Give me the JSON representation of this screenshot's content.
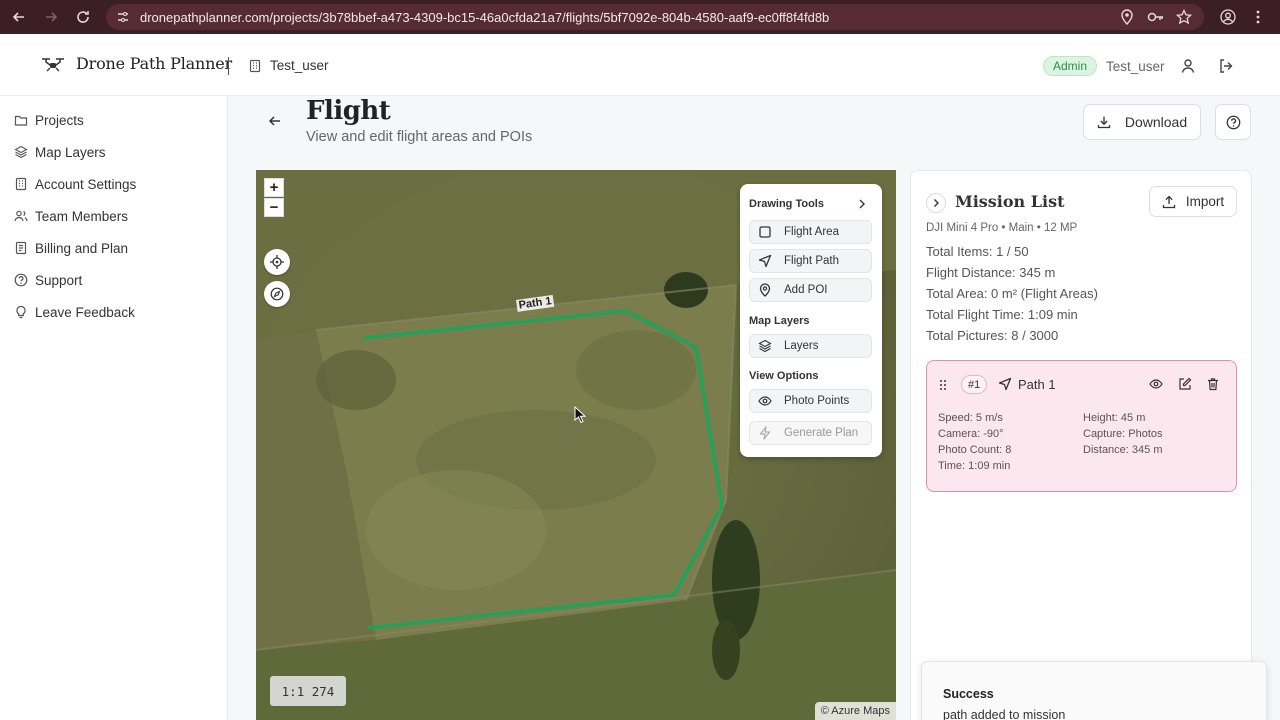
{
  "browser": {
    "url": "dronepathplanner.com/projects/3b78bbef-a473-4309-bc15-46a0cfda21a7/flights/5bf7092e-804b-4580-aaf9-ec0ff8f4fd8b"
  },
  "header": {
    "brand": "Drone Path Planner",
    "workspace": "Test_user",
    "role_badge": "Admin",
    "user": "Test_user"
  },
  "sidebar": {
    "items": [
      {
        "label": "Projects",
        "icon": "folder-icon"
      },
      {
        "label": "Map Layers",
        "icon": "layers-icon"
      },
      {
        "label": "Account Settings",
        "icon": "building-icon"
      },
      {
        "label": "Team Members",
        "icon": "users-icon"
      },
      {
        "label": "Billing and Plan",
        "icon": "receipt-icon"
      },
      {
        "label": "Support",
        "icon": "help-icon"
      },
      {
        "label": "Leave Feedback",
        "icon": "lightbulb-icon"
      }
    ]
  },
  "page": {
    "title": "Flight",
    "subtitle": "View and edit flight areas and POIs",
    "download_label": "Download"
  },
  "map": {
    "zoom_in": "+",
    "zoom_out": "−",
    "path_label": "Path 1",
    "scale": "1:1 274",
    "attribution": "© Azure Maps",
    "path_color": "#1fa35a"
  },
  "tools": {
    "drawing_title": "Drawing Tools",
    "flight_area": "Flight Area",
    "flight_path": "Flight Path",
    "add_poi": "Add POI",
    "map_layers_title": "Map Layers",
    "layers": "Layers",
    "view_options_title": "View Options",
    "photo_points": "Photo Points",
    "generate_plan": "Generate Plan"
  },
  "mission": {
    "title": "Mission List",
    "import_label": "Import",
    "drone": "DJI Mini 4 Pro • Main • 12 MP",
    "stats": [
      "Total Items: 1 / 50",
      "Flight Distance: 345 m",
      "Total Area: 0 m² (Flight Areas)",
      "Total Flight Time: 1:09 min",
      "Total Pictures: 8 / 3000"
    ],
    "item": {
      "number": "#1",
      "name": "Path 1",
      "speed": "Speed: 5 m/s",
      "height": "Height: 45 m",
      "camera": "Camera: -90°",
      "capture": "Capture: Photos",
      "photo_count": "Photo Count: 8",
      "distance": "Distance: 345 m",
      "time": "Time: 1:09 min"
    }
  },
  "toast": {
    "title": "Success",
    "message": "path added to mission"
  }
}
